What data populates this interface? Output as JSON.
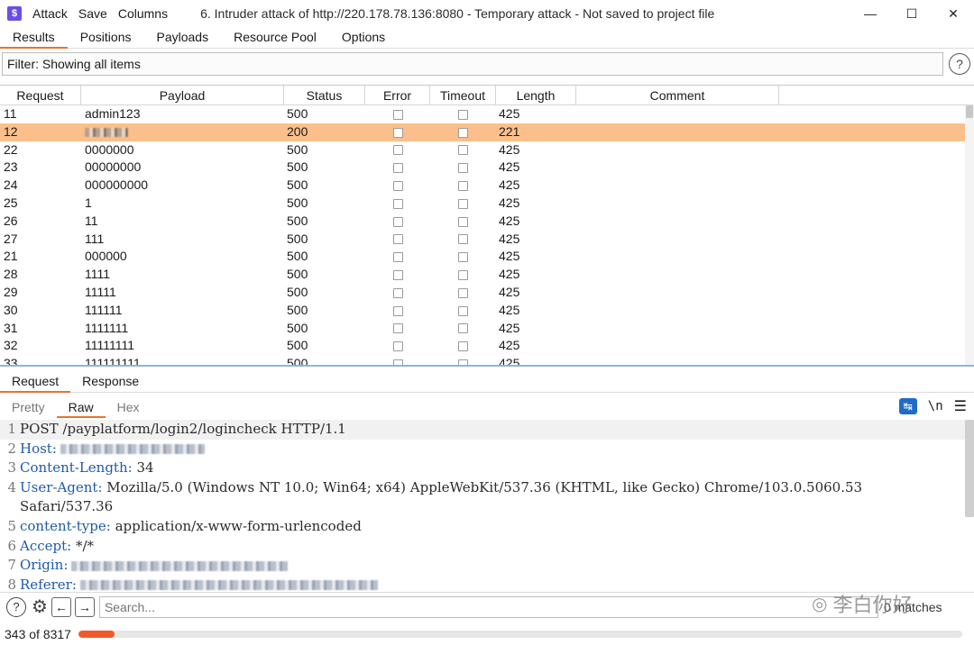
{
  "menubar": {
    "items": [
      "Attack",
      "Save",
      "Columns"
    ],
    "title": "6. Intruder attack of http://220.178.78.136:8080 - Temporary attack - Not saved to project file"
  },
  "main_tabs": [
    "Results",
    "Positions",
    "Payloads",
    "Resource Pool",
    "Options"
  ],
  "filter": {
    "label": "Filter: Showing all items"
  },
  "table": {
    "headers": [
      "Request",
      "Payload",
      "Status",
      "Error",
      "Timeout",
      "Length",
      "Comment"
    ],
    "rows": [
      {
        "request": "11",
        "payload": "admin123",
        "status": "500",
        "length": "425",
        "selected": false,
        "redacted": false
      },
      {
        "request": "12",
        "payload": "",
        "status": "200",
        "length": "221",
        "selected": true,
        "redacted": true
      },
      {
        "request": "22",
        "payload": "0000000",
        "status": "500",
        "length": "425",
        "selected": false,
        "redacted": false
      },
      {
        "request": "23",
        "payload": "00000000",
        "status": "500",
        "length": "425",
        "selected": false,
        "redacted": false
      },
      {
        "request": "24",
        "payload": "000000000",
        "status": "500",
        "length": "425",
        "selected": false,
        "redacted": false
      },
      {
        "request": "25",
        "payload": "1",
        "status": "500",
        "length": "425",
        "selected": false,
        "redacted": false
      },
      {
        "request": "26",
        "payload": "11",
        "status": "500",
        "length": "425",
        "selected": false,
        "redacted": false
      },
      {
        "request": "27",
        "payload": "111",
        "status": "500",
        "length": "425",
        "selected": false,
        "redacted": false
      },
      {
        "request": "21",
        "payload": "000000",
        "status": "500",
        "length": "425",
        "selected": false,
        "redacted": false
      },
      {
        "request": "28",
        "payload": "1111",
        "status": "500",
        "length": "425",
        "selected": false,
        "redacted": false
      },
      {
        "request": "29",
        "payload": "11111",
        "status": "500",
        "length": "425",
        "selected": false,
        "redacted": false
      },
      {
        "request": "30",
        "payload": "111111",
        "status": "500",
        "length": "425",
        "selected": false,
        "redacted": false
      },
      {
        "request": "31",
        "payload": "1111111",
        "status": "500",
        "length": "425",
        "selected": false,
        "redacted": false
      },
      {
        "request": "32",
        "payload": "11111111",
        "status": "500",
        "length": "425",
        "selected": false,
        "redacted": false
      },
      {
        "request": "33",
        "payload": "111111111",
        "status": "500",
        "length": "425",
        "selected": false,
        "redacted": false
      }
    ]
  },
  "rr_tabs": [
    "Request",
    "Response"
  ],
  "sub_tabs": [
    "Pretty",
    "Raw",
    "Hex"
  ],
  "sub_icons": {
    "newline": "\\n"
  },
  "request_lines": [
    {
      "n": "1",
      "key": "",
      "val": "POST /payplatform/login2/logincheck HTTP/1.1"
    },
    {
      "n": "2",
      "key": "Host:",
      "val": ""
    },
    {
      "n": "3",
      "key": "Content-Length:",
      "val": " 34"
    },
    {
      "n": "4",
      "key": "User-Agent:",
      "val": " Mozilla/5.0 (Windows NT 10.0; Win64; x64) AppleWebKit/537.36 (KHTML, like Gecko) Chrome/103.0.5060.53"
    },
    {
      "n": "",
      "key": "",
      "val": "Safari/537.36"
    },
    {
      "n": "5",
      "key": "content-type:",
      "val": " application/x-www-form-urlencoded"
    },
    {
      "n": "6",
      "key": "Accept:",
      "val": " */*"
    },
    {
      "n": "7",
      "key": "Origin:",
      "val": ""
    },
    {
      "n": "8",
      "key": "Referer:",
      "val": ""
    }
  ],
  "search": {
    "placeholder": "Search...",
    "matches": "0 matches"
  },
  "status": {
    "progress_text": "343 of 8317",
    "progress_fraction": 0.04124
  },
  "watermark": {
    "text": "李白你好"
  }
}
